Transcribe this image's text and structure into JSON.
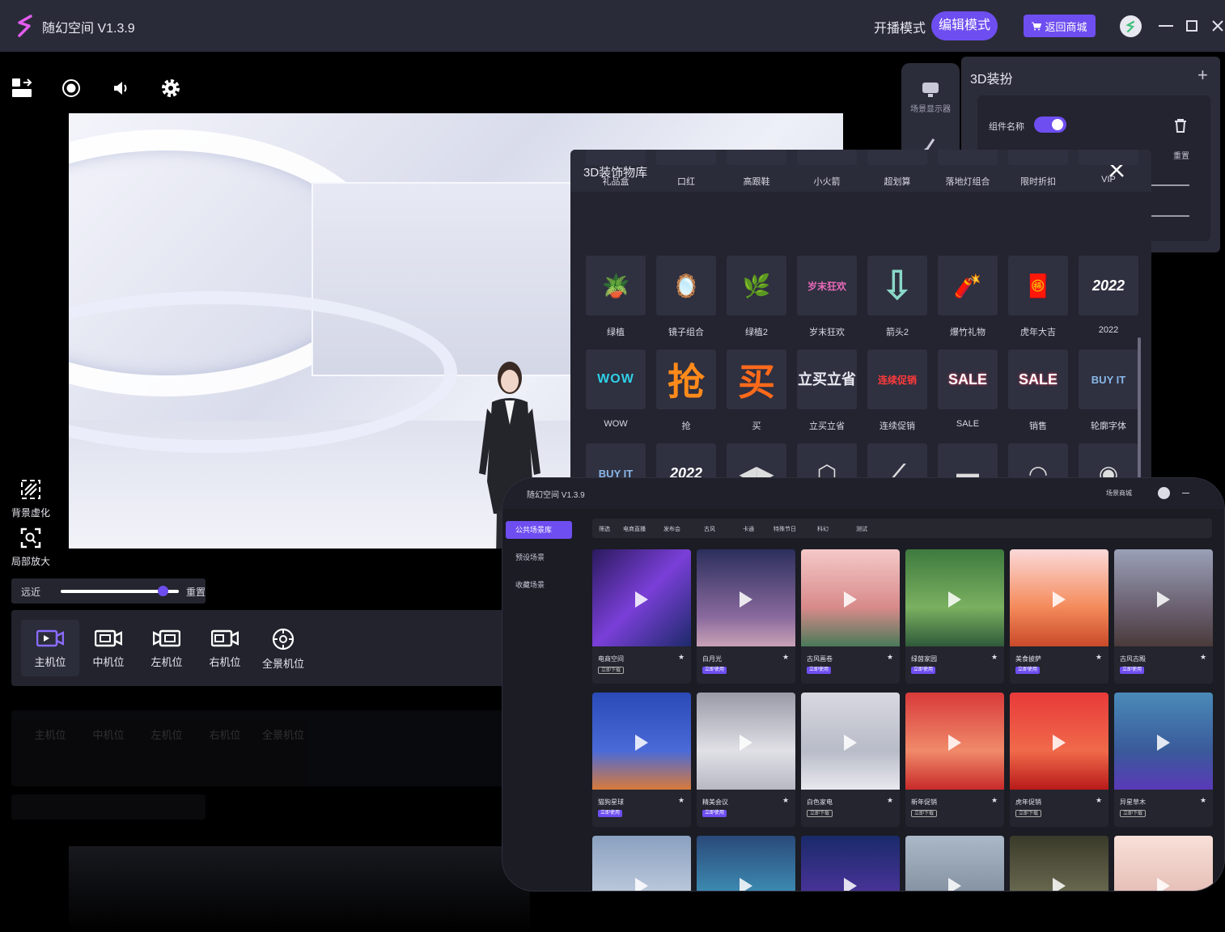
{
  "app": {
    "title": "随幻空间 V1.3.9",
    "mode_live": "开播模式",
    "mode_edit": "编辑模式",
    "shop_label": "返回商城",
    "accent": "#6e4ef0"
  },
  "toolbar": {
    "icons": [
      "layout-icon",
      "record-icon",
      "volume-icon",
      "settings-icon"
    ]
  },
  "side_tools": [
    {
      "label": "背景虚化",
      "icon": "blur-icon"
    },
    {
      "label": "局部放大",
      "icon": "zoom-icon"
    }
  ],
  "distance": {
    "far_near": "远近",
    "reset": "重置",
    "value": 0.85
  },
  "cameras": [
    {
      "label": "主机位",
      "icon": "main-camera-icon",
      "active": true
    },
    {
      "label": "中机位",
      "icon": "mid-camera-icon",
      "active": false
    },
    {
      "label": "左机位",
      "icon": "left-camera-icon",
      "active": false
    },
    {
      "label": "右机位",
      "icon": "right-camera-icon",
      "active": false
    },
    {
      "label": "全景机位",
      "icon": "panorama-camera-icon",
      "active": false
    }
  ],
  "dock": {
    "scene_display": "场景显示器"
  },
  "decoration": {
    "title": "3D装扮",
    "component_name": "组件名称",
    "reset": "重置",
    "enabled": true
  },
  "library": {
    "title": "3D装饰物库",
    "rows": [
      [
        {
          "label": "礼品盒"
        },
        {
          "label": "口红"
        },
        {
          "label": "高跟鞋"
        },
        {
          "label": "小火箭"
        },
        {
          "label": "超划算"
        },
        {
          "label": "落地灯组合"
        },
        {
          "label": "限时折扣"
        },
        {
          "label": "VIP"
        }
      ],
      [
        {
          "label": "绿植",
          "thumb": "🪴"
        },
        {
          "label": "镜子组合",
          "thumb": "🪞"
        },
        {
          "label": "绿植2",
          "thumb": "🌿"
        },
        {
          "label": "岁末狂欢",
          "thumb": "岁末狂欢"
        },
        {
          "label": "箭头2",
          "thumb": "⇩"
        },
        {
          "label": "爆竹礼物",
          "thumb": "🧨"
        },
        {
          "label": "虎年大吉",
          "thumb": "🧧"
        },
        {
          "label": "2022",
          "thumb": "2022"
        }
      ],
      [
        {
          "label": "WOW",
          "thumb": "WOW"
        },
        {
          "label": "抢",
          "thumb": "抢"
        },
        {
          "label": "买",
          "thumb": "买"
        },
        {
          "label": "立买立省",
          "thumb": "立买立省"
        },
        {
          "label": "连续促销",
          "thumb": "连续促销"
        },
        {
          "label": "SALE",
          "thumb": "SALE"
        },
        {
          "label": "销售",
          "thumb": "SALE"
        },
        {
          "label": "轮廓字体",
          "thumb": "BUY IT"
        }
      ],
      [
        {
          "thumb": "BUY IT"
        },
        {
          "thumb": "2022"
        },
        {
          "thumb": "◀▶"
        },
        {
          "thumb": "⬡"
        },
        {
          "thumb": "⟋"
        },
        {
          "thumb": "▬"
        },
        {
          "thumb": "◠"
        },
        {
          "thumb": "◉"
        }
      ]
    ]
  },
  "scene_window": {
    "title": "随幻空间 V1.3.9",
    "shop": "场景商城",
    "nav": [
      {
        "label": "公共场景库",
        "active": true
      },
      {
        "label": "预设场景",
        "active": false
      },
      {
        "label": "收藏场景",
        "active": false
      }
    ],
    "filters": [
      "筛选",
      "电商直播",
      "发布会",
      "古风",
      "卡通",
      "特殊节日",
      "科幻",
      "测试"
    ],
    "cards": [
      {
        "name": "电商空间",
        "tag": "立即下载",
        "bg": "linear-gradient(135deg,#2a1a5e,#7a3fd8 50%,#1d2a6a)"
      },
      {
        "name": "白月光",
        "tag": "立即使用",
        "bg": "linear-gradient(180deg,#2b2f5c,#8a6a9e 70%,#c9a2b6)"
      },
      {
        "name": "古风画卷",
        "tag": "立即使用",
        "bg": "linear-gradient(180deg,#f5c8c8,#d88a8a 60%,#4a7a5a)"
      },
      {
        "name": "绿茵家园",
        "tag": "立即使用",
        "bg": "linear-gradient(180deg,#3e7a3e,#7ab060 60%,#2f5a3a)"
      },
      {
        "name": "美食披萨",
        "tag": "立即使用",
        "bg": "linear-gradient(180deg,#fbd9d9,#f48a5a 60%,#c94a2a)"
      },
      {
        "name": "古风古殿",
        "tag": "立即使用",
        "bg": "linear-gradient(180deg,#9aa0b8,#6a6070 60%,#4a3a3a)"
      },
      {
        "name": "猫狗星球",
        "tag": "立即使用",
        "bg": "linear-gradient(180deg,#2a4ab8,#4a6ad8 60%,#d87a3a)"
      },
      {
        "name": "精美会议",
        "tag": "立即使用",
        "bg": "linear-gradient(180deg,#9a9aa8,#e0e0e6 60%,#b8b8c4)"
      },
      {
        "name": "白色家电",
        "tag": "立即下载",
        "bg": "linear-gradient(180deg,#d8d8e0,#b8bcc8 60%,#e8e8ee)"
      },
      {
        "name": "新年促销",
        "tag": "立即下载",
        "bg": "linear-gradient(180deg,#d83a3a,#f08a6a 60%,#c92a2a)"
      },
      {
        "name": "虎年促销",
        "tag": "立即下载",
        "bg": "linear-gradient(180deg,#e83a3a,#f06a4a 60%,#b81a1a)"
      },
      {
        "name": "异星草木",
        "tag": "立即下载",
        "bg": "linear-gradient(180deg,#4a8ab8,#3a5a9a 60%,#5a3ab8)"
      },
      {
        "name": "",
        "tag": "",
        "bg": "linear-gradient(180deg,#8aa0c0,#dde4ee)"
      },
      {
        "name": "",
        "tag": "",
        "bg": "linear-gradient(180deg,#2a4a7a,#4ab8d8)"
      },
      {
        "name": "",
        "tag": "",
        "bg": "linear-gradient(180deg,#1a2a6a,#6a3ab8)"
      },
      {
        "name": "",
        "tag": "",
        "bg": "linear-gradient(180deg,#aab8c8,#6a7888)"
      },
      {
        "name": "",
        "tag": "",
        "bg": "linear-gradient(180deg,#3a3a2a,#8a8a6a)"
      },
      {
        "name": "",
        "tag": "",
        "bg": "linear-gradient(180deg,#f8e0d8,#d8a8a0)"
      }
    ]
  }
}
